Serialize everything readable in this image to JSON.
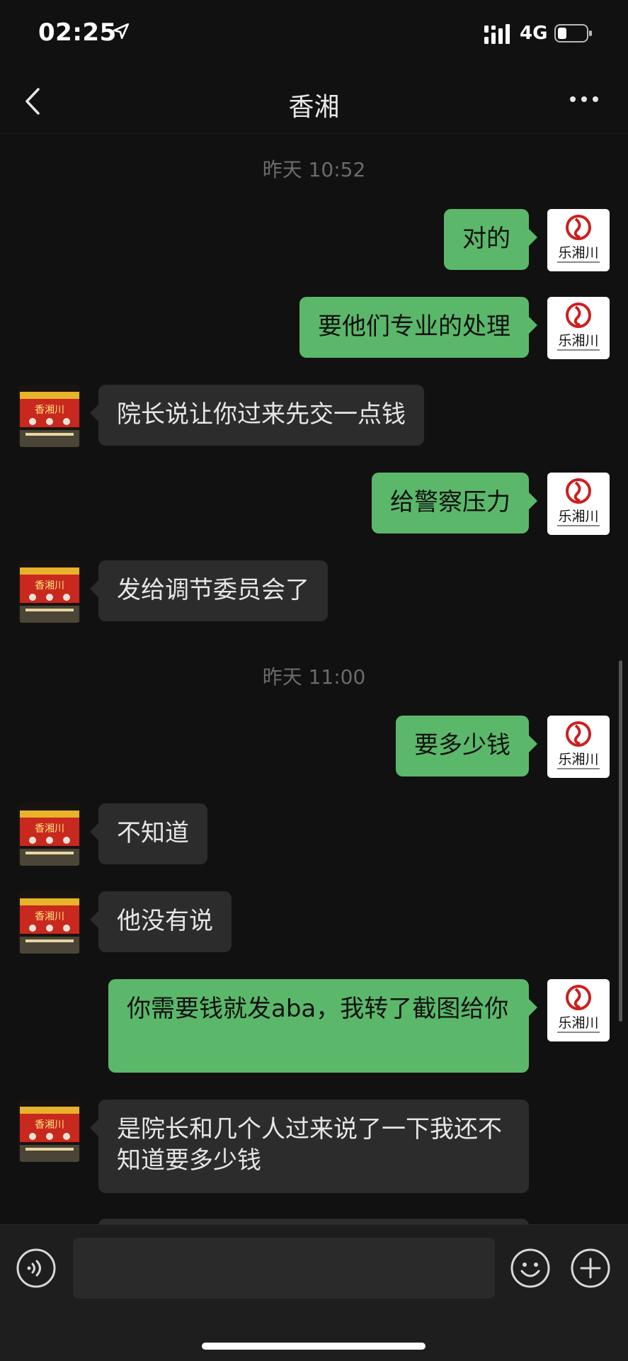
{
  "status_bar": {
    "time": "02:25",
    "network": "4G"
  },
  "header": {
    "title": "香湘"
  },
  "timestamps": [
    "昨天 10:52",
    "昨天 11:00"
  ],
  "messages": [
    {
      "side": "me",
      "text": "对的"
    },
    {
      "side": "me",
      "text": "要他们专业的处理"
    },
    {
      "side": "other",
      "text": "院长说让你过来先交一点钱"
    },
    {
      "side": "me",
      "text": "给警察压力"
    },
    {
      "side": "other",
      "text": "发给调节委员会了"
    },
    {
      "side": "me",
      "text": "要多少钱"
    },
    {
      "side": "other",
      "text": "不知道"
    },
    {
      "side": "other",
      "text": "他没有说"
    },
    {
      "side": "me",
      "text": "你需要钱就发aba，我转了截图给你"
    },
    {
      "side": "other",
      "text": "是院长和几个人过来说了一下我还不知道要多少钱"
    }
  ],
  "avatars": {
    "me_logo_text": "乐湘川",
    "other_sign_text": "香湘川"
  },
  "colors": {
    "background": "#111111",
    "bubble_me": "#5bb86a",
    "bubble_other": "#2c2c2c",
    "input_bar": "#1e1e1e"
  },
  "icons": {
    "back": "chevron-left-icon",
    "more": "more-dots-icon",
    "voice": "voice-icon",
    "emoji": "emoji-icon",
    "plus": "plus-icon",
    "location": "location-arrow-icon",
    "signal": "signal-icon",
    "battery": "battery-icon"
  }
}
